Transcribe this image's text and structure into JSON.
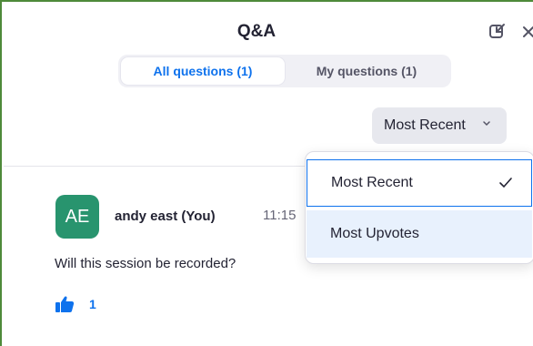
{
  "header": {
    "title": "Q&A"
  },
  "tabs": [
    {
      "label": "All questions (1)",
      "active": true
    },
    {
      "label": "My questions (1)",
      "active": false
    }
  ],
  "sort": {
    "selected_label": "Most Recent",
    "options": [
      {
        "label": "Most Recent",
        "selected": true
      },
      {
        "label": "Most Upvotes",
        "selected": false
      }
    ]
  },
  "question": {
    "avatar_initials": "AE",
    "author": "andy east (You)",
    "time": "11:15",
    "text": "Will this session be recorded?",
    "upvotes": "1"
  },
  "icons": {
    "popout": "popout-icon",
    "close": "close-icon",
    "chevron": "chevron-down-icon",
    "check": "check-icon",
    "thumb": "thumbs-up-icon"
  },
  "colors": {
    "accent": "#0e72ed",
    "avatar": "#28946e",
    "frame": "#4e8a3a"
  }
}
